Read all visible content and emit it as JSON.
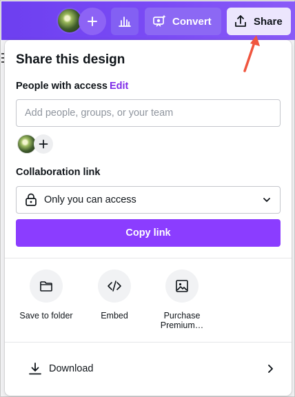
{
  "topbar": {
    "convert_label": "Convert",
    "share_label": "Share",
    "accent_color": "#7b4cf5"
  },
  "panel": {
    "title": "Share this design",
    "people_label": "People with access",
    "edit_label": "Edit",
    "people_placeholder": "Add people, groups, or your team",
    "collab_label": "Collaboration link",
    "access_value": "Only you can access",
    "copy_label": "Copy link",
    "button_color": "#8b3dff"
  },
  "actions": [
    {
      "label": "Save to folder",
      "icon": "folder-icon"
    },
    {
      "label": "Embed",
      "icon": "code-icon"
    },
    {
      "label": "Purchase Premium…",
      "icon": "image-icon"
    }
  ],
  "download": {
    "label": "Download",
    "icon": "download-icon"
  }
}
